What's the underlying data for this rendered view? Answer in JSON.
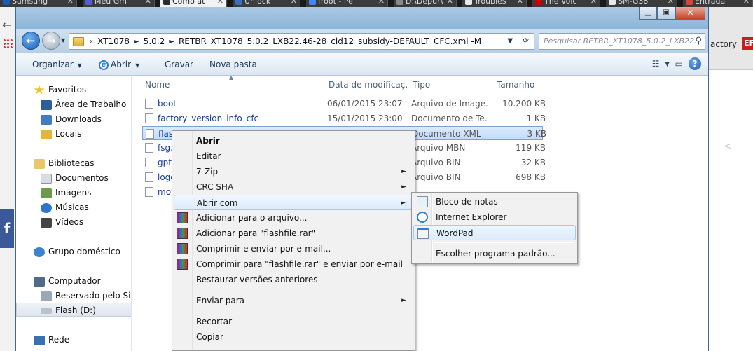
{
  "browser_tabs": [
    {
      "label": "Samsung",
      "color": "#1a5fb4"
    },
    {
      "label": "Meu Gm",
      "color": "#5a5ad6"
    },
    {
      "label": "Como at",
      "color": "#2c2c2c",
      "active": true
    },
    {
      "label": "Unlock",
      "color": "#3c6ec1"
    },
    {
      "label": "froot - Pe",
      "color": "#4285f4"
    },
    {
      "label": "D:\\Depur\\",
      "color": "#888888"
    },
    {
      "label": "Troubles",
      "color": "#e8e8e8"
    },
    {
      "label": "The Voic",
      "color": "#cc0000"
    },
    {
      "label": "SM-G38",
      "color": "#e8e8e8"
    },
    {
      "label": "Entrada",
      "color": "#d44638"
    }
  ],
  "browser_side": {
    "factory_link": "actory",
    "red_badge": "EF",
    "fb_label": "f"
  },
  "address": {
    "segments": [
      "XT1078",
      "5.0.2",
      "RETBR_XT1078_5.0.2_LXB22.46-28_cid12_subsidy-DEFAULT_CFC.xml -M"
    ],
    "lead": "«"
  },
  "search": {
    "placeholder": "Pesquisar RETBR_XT1078_5.0.2_LXB22..."
  },
  "toolbar": {
    "organize_label": "Organizar",
    "open_label": "Abrir",
    "save_label": "Gravar",
    "new_folder_label": "Nova pasta"
  },
  "nav_pane": {
    "favorites": "Favoritos",
    "desktop": "Área de Trabalho",
    "downloads": "Downloads",
    "places": "Locais",
    "libraries": "Bibliotecas",
    "documents": "Documentos",
    "images": "Imagens",
    "music": "Músicas",
    "videos": "Vídeos",
    "homegroup": "Grupo doméstico",
    "computer": "Computador",
    "reserved": "Reservado pelo Siste",
    "flash": "Flash (D:)",
    "network": "Rede"
  },
  "columns": {
    "name": "Nome",
    "date": "Data de modificaç...",
    "type": "Tipo",
    "size": "Tamanho"
  },
  "files": [
    {
      "name": "boot",
      "date": "06/01/2015 23:07",
      "type": "Arquivo de Image...",
      "size": "10.200 KB"
    },
    {
      "name": "factory_version_info_cfc",
      "date": "15/01/2015 23:00",
      "type": "Documento de Te...",
      "size": "1 KB"
    },
    {
      "name": "flas",
      "date": "",
      "type": "Documento XML",
      "size": "3 KB"
    },
    {
      "name": "fsg.",
      "date": "",
      "type": "Arquivo MBN",
      "size": "119 KB"
    },
    {
      "name": "gpt",
      "date": "",
      "type": "Arquivo BIN",
      "size": "32 KB"
    },
    {
      "name": "logo",
      "date": "",
      "type": "Arquivo BIN",
      "size": "698 KB"
    },
    {
      "name": "mo",
      "date": "",
      "type": "",
      "size": ""
    }
  ],
  "context_menu": {
    "open": "Abrir",
    "edit": "Editar",
    "seven_zip": "7-Zip",
    "crc_sha": "CRC SHA",
    "open_with": "Abrir com",
    "add_archive": "Adicionar para o arquivo...",
    "add_rar": "Adicionar para \"flashfile.rar\"",
    "compress_email": "Comprimir e enviar por e-mail...",
    "compress_rar_email": "Comprimir para \"flashfile.rar\" e enviar por e-mail",
    "restore": "Restaurar versões anteriores",
    "send_to": "Enviar para",
    "cut": "Recortar",
    "copy": "Copiar"
  },
  "open_with_menu": {
    "notepad": "Bloco de notas",
    "ie": "Internet Explorer",
    "wordpad": "WordPad",
    "choose": "Escolher programa padrão..."
  }
}
